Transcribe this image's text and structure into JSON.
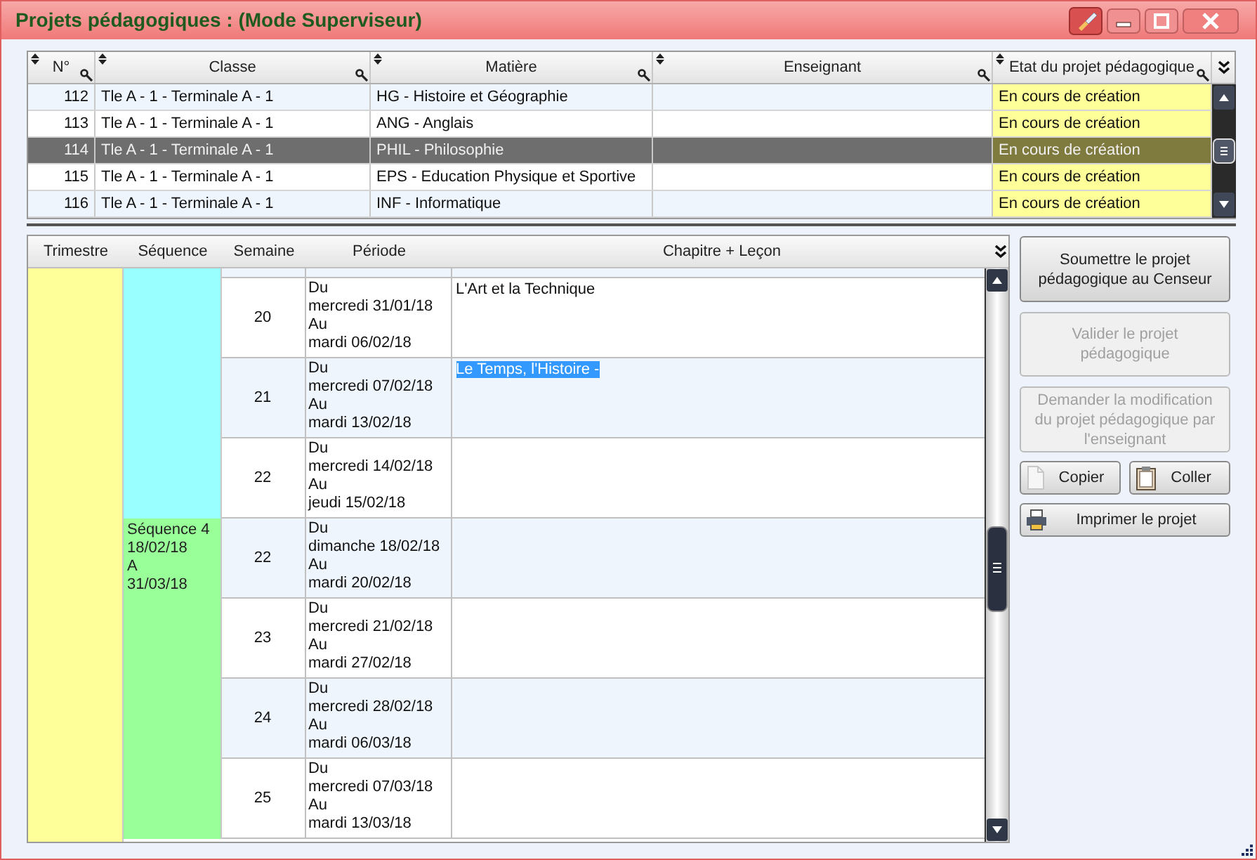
{
  "window": {
    "title": "Projets pédagogiques : (Mode Superviseur)"
  },
  "projects_table": {
    "columns": [
      "N°",
      "Classe",
      "Matière",
      "Enseignant",
      "Etat du projet pédagogique"
    ],
    "rows": [
      {
        "number": "112",
        "class": "Tle A - 1 - Terminale A - 1",
        "subject": "HG - Histoire et Géographie",
        "state": "En cours de création",
        "selected": false
      },
      {
        "number": "113",
        "class": "Tle A - 1 - Terminale A - 1",
        "subject": "ANG - Anglais",
        "state": "En cours de création",
        "selected": false
      },
      {
        "number": "114",
        "class": "Tle A - 1 - Terminale A - 1",
        "subject": "PHIL - Philosophie",
        "state": "En cours de création",
        "selected": true
      },
      {
        "number": "115",
        "class": "Tle A - 1 - Terminale A - 1",
        "subject": "EPS - Education Physique et Sportive",
        "state": "En cours de création",
        "selected": false
      },
      {
        "number": "116",
        "class": "Tle A - 1 - Terminale A - 1",
        "subject": "INF - Informatique",
        "state": "En cours de création",
        "selected": false
      }
    ]
  },
  "schedule": {
    "columns": [
      "Trimestre",
      "Séquence",
      "Semaine",
      "Période",
      "Chapitre + Leçon"
    ],
    "sequences": [
      {
        "color": "#99ffff",
        "weeks": [
          {
            "week": "20",
            "period": "Du\nmercredi 31/01/18\nAu\nmardi 06/02/18",
            "chapter": "L'Art et la Technique",
            "highlighted": false
          },
          {
            "week": "21",
            "period": "Du\nmercredi 07/02/18\nAu\nmardi 13/02/18",
            "chapter": "Le Temps, l'Histoire -",
            "highlighted": true
          },
          {
            "week": "22",
            "period": "Du\nmercredi 14/02/18\nAu\njeudi 15/02/18"
          }
        ]
      },
      {
        "label": "Séquence 4\n18/02/18\nA\n31/03/18",
        "color": "#99ff99",
        "weeks": [
          {
            "week": "22",
            "period": "Du\ndimanche 18/02/18\nAu\nmardi 20/02/18"
          },
          {
            "week": "23",
            "period": "Du\nmercredi 21/02/18\nAu\nmardi 27/02/18"
          },
          {
            "week": "24",
            "period": "Du\nmercredi 28/02/18\nAu\nmardi 06/03/18"
          },
          {
            "week": "25",
            "period": "Du\nmercredi 07/03/18\nAu\nmardi 13/03/18"
          }
        ]
      }
    ]
  },
  "action_buttons": [
    {
      "label": "Soumettre le projet pédagogique au Censeur",
      "disabled": false
    },
    {
      "label": "Valider le projet pédagogique",
      "disabled": true
    },
    {
      "label": "Demander la modification du projet pédagogique par l'enseignant",
      "disabled": true
    }
  ],
  "tool_buttons": [
    {
      "kind": "copy",
      "label": "Copier"
    },
    {
      "kind": "paste",
      "label": "Coller"
    },
    {
      "kind": "print",
      "label": "Imprimer le projet"
    }
  ]
}
